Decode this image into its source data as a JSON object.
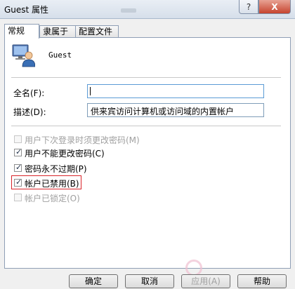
{
  "window": {
    "title": "Guest 属性",
    "help_glyph": "?",
    "close_glyph": "X"
  },
  "tabs": [
    "常规",
    "隶属于",
    "配置文件"
  ],
  "user": {
    "name": "Guest",
    "icon": "user-account-icon"
  },
  "fields": {
    "fullname_label": "全名(F):",
    "fullname_value": "",
    "description_label": "描述(D):",
    "description_value": "供来宾访问计算机或访问域的内置帐户"
  },
  "options": [
    {
      "label": "用户下次登录时须更改密码(M)",
      "checked": false,
      "enabled": false
    },
    {
      "label": "用户不能更改密码(C)",
      "checked": true,
      "enabled": true
    },
    {
      "label": "密码永不过期(P)",
      "checked": true,
      "enabled": true
    },
    {
      "label": "帐户已禁用(B)",
      "checked": true,
      "enabled": true
    },
    {
      "label": "帐户已锁定(O)",
      "checked": false,
      "enabled": false
    }
  ],
  "buttons": {
    "ok": "确定",
    "cancel": "取消",
    "apply": "应用(A)",
    "help": "帮助"
  },
  "colors": {
    "highlight_box": "#d9242a",
    "accent": "#5b9bd5"
  }
}
